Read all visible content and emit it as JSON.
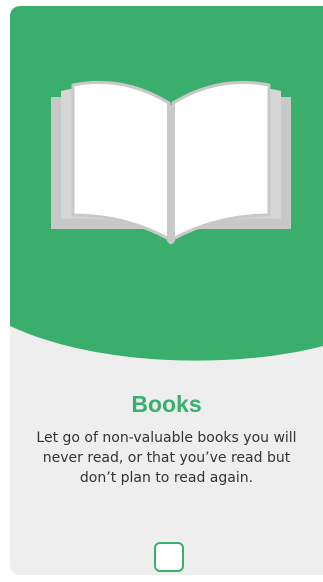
{
  "card": {
    "title": "Books",
    "description": "Let go of non-valuable books you will never read, or that you’ve read but don’t plan to read again.",
    "checked": false,
    "icon": "open-book-icon"
  },
  "colors": {
    "accent": "#3aaf6d",
    "card_background": "#eeeeee",
    "book_page": "#ffffff",
    "book_outline": "#c8c8c8"
  }
}
